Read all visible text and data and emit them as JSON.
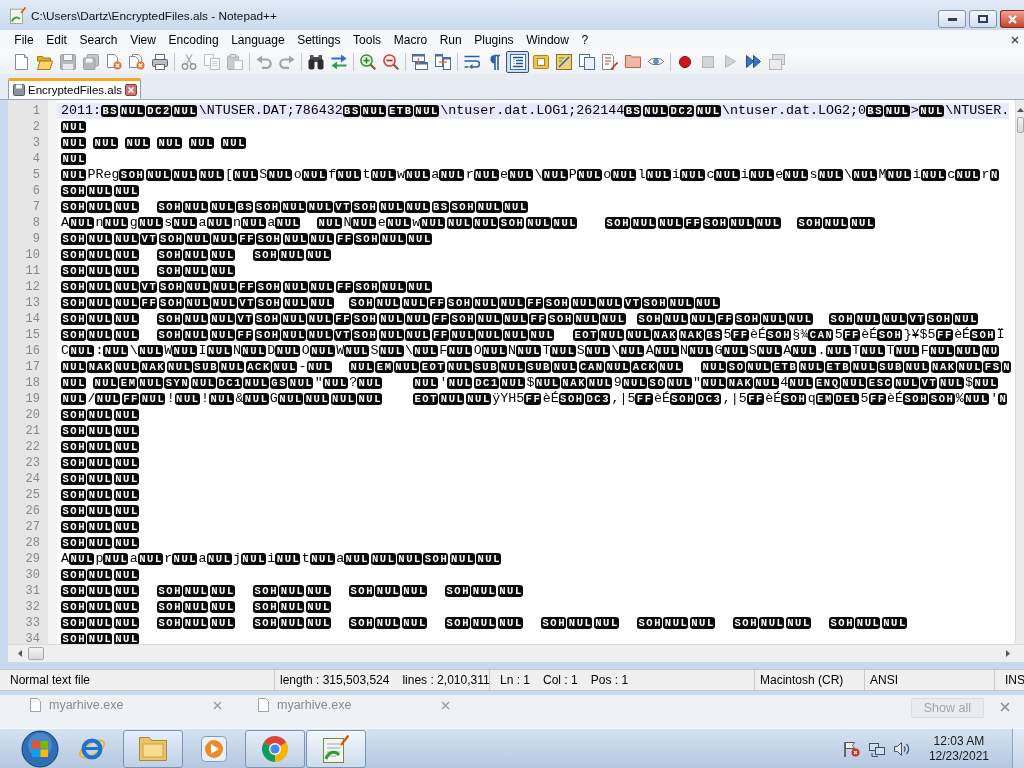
{
  "window": {
    "title": "C:\\Users\\Dartz\\EncryptedFiles.als - Notepad++"
  },
  "menu": [
    "File",
    "Edit",
    "Search",
    "View",
    "Encoding",
    "Language",
    "Settings",
    "Tools",
    "Macro",
    "Run",
    "Plugins",
    "Window",
    "?"
  ],
  "toolbar": [
    {
      "kind": "new",
      "pressed": false,
      "disabled": false
    },
    {
      "kind": "open",
      "pressed": false,
      "disabled": false
    },
    {
      "kind": "save",
      "pressed": false,
      "disabled": true
    },
    {
      "kind": "saveall",
      "pressed": false,
      "disabled": true
    },
    {
      "kind": "close",
      "pressed": false,
      "disabled": false
    },
    {
      "kind": "closeall",
      "pressed": false,
      "disabled": false
    },
    {
      "kind": "print",
      "pressed": false,
      "disabled": false
    },
    {
      "kind": "separator"
    },
    {
      "kind": "cut",
      "pressed": false,
      "disabled": true
    },
    {
      "kind": "copy",
      "pressed": false,
      "disabled": true
    },
    {
      "kind": "paste",
      "pressed": false,
      "disabled": true
    },
    {
      "kind": "separator"
    },
    {
      "kind": "undo",
      "pressed": false,
      "disabled": true
    },
    {
      "kind": "redo",
      "pressed": false,
      "disabled": true
    },
    {
      "kind": "separator"
    },
    {
      "kind": "find",
      "pressed": false,
      "disabled": false
    },
    {
      "kind": "replace",
      "pressed": false,
      "disabled": false
    },
    {
      "kind": "separator"
    },
    {
      "kind": "zoomin",
      "pressed": false,
      "disabled": false
    },
    {
      "kind": "zoomout",
      "pressed": false,
      "disabled": false
    },
    {
      "kind": "separator"
    },
    {
      "kind": "syncv",
      "pressed": false,
      "disabled": false
    },
    {
      "kind": "synch",
      "pressed": false,
      "disabled": false
    },
    {
      "kind": "separator"
    },
    {
      "kind": "wrap",
      "pressed": false,
      "disabled": false
    },
    {
      "kind": "allchars",
      "pressed": false,
      "disabled": false
    },
    {
      "kind": "indentguide",
      "pressed": true,
      "disabled": false
    },
    {
      "kind": "udl",
      "pressed": false,
      "disabled": false
    },
    {
      "kind": "docmap",
      "pressed": false,
      "disabled": false
    },
    {
      "kind": "doclist",
      "pressed": false,
      "disabled": false
    },
    {
      "kind": "funclist",
      "pressed": false,
      "disabled": false
    },
    {
      "kind": "folder",
      "pressed": false,
      "disabled": false
    },
    {
      "kind": "monitor",
      "pressed": false,
      "disabled": false
    },
    {
      "kind": "separator"
    },
    {
      "kind": "record",
      "pressed": false,
      "disabled": false
    },
    {
      "kind": "stop",
      "pressed": false,
      "disabled": true
    },
    {
      "kind": "play",
      "pressed": false,
      "disabled": true
    },
    {
      "kind": "playmulti",
      "pressed": false,
      "disabled": false
    },
    {
      "kind": "savemacro",
      "pressed": false,
      "disabled": true
    }
  ],
  "tabs": [
    {
      "label": "EncryptedFiles.als",
      "selected": true
    }
  ],
  "editor": {
    "lines": [
      {
        "number": "1",
        "current": true,
        "groups": [
          [
            {
              "text": "2011:",
              "controls": [
                "BS",
                "NUL",
                "DC2",
                "NUL"
              ]
            },
            {
              "text": "\\NTUSER.DAT;786432",
              "controls": [
                "BS",
                "NUL",
                "ETB",
                "NUL"
              ]
            },
            {
              "text": "\\ntuser.dat.LOG1;262144",
              "controls": [
                "BS",
                "NUL",
                "DC2",
                "NUL"
              ]
            },
            {
              "text": "\\ntuser.dat.LOG2;0",
              "controls": [
                "BS",
                "NUL"
              ]
            },
            {
              "text": ">",
              "controls": [
                "NUL"
              ]
            },
            {
              "text": "\\NTUSER."
            }
          ]
        ]
      },
      {
        "number": "2",
        "current": false,
        "groups": [
          [
            {
              "controls": [
                "NUL"
              ]
            }
          ]
        ]
      },
      {
        "number": "3",
        "current": false,
        "groups": [
          [
            {
              "controls": [
                "NUL"
              ]
            }
          ],
          [
            {
              "controls": [
                "NUL"
              ]
            }
          ],
          [
            {
              "controls": [
                "NUL"
              ]
            }
          ],
          [
            {
              "controls": [
                "NUL"
              ]
            }
          ],
          [
            {
              "controls": [
                "NUL"
              ]
            }
          ],
          [
            {
              "controls": [
                "NUL"
              ]
            }
          ]
        ]
      },
      {
        "number": "4",
        "current": false,
        "groups": [
          [
            {
              "controls": [
                "NUL"
              ]
            }
          ]
        ]
      },
      {
        "number": "5",
        "current": false,
        "groups": [
          [
            {
              "controls": [
                "NUL"
              ]
            },
            {
              "text": "PReg",
              "controls": [
                "SOH",
                "NUL",
                "NUL",
                "NUL"
              ]
            },
            {
              "text": "[",
              "controls": [
                "NUL"
              ]
            },
            {
              "text": "S",
              "controls": [
                "NUL"
              ]
            },
            {
              "text": "o",
              "controls": [
                "NUL"
              ]
            },
            {
              "text": "f",
              "controls": [
                "NUL"
              ]
            },
            {
              "text": "t",
              "controls": [
                "NUL"
              ]
            },
            {
              "text": "w",
              "controls": [
                "NUL"
              ]
            },
            {
              "text": "a",
              "controls": [
                "NUL"
              ]
            },
            {
              "text": "r",
              "controls": [
                "NUL"
              ]
            },
            {
              "text": "e",
              "controls": [
                "NUL"
              ]
            },
            {
              "text": "\\",
              "controls": [
                "NUL"
              ]
            },
            {
              "text": "P",
              "controls": [
                "NUL"
              ]
            },
            {
              "text": "o",
              "controls": [
                "NUL"
              ]
            },
            {
              "text": "l",
              "controls": [
                "NUL"
              ]
            },
            {
              "text": "i",
              "controls": [
                "NUL"
              ]
            },
            {
              "text": "c",
              "controls": [
                "NUL"
              ]
            },
            {
              "text": "i",
              "controls": [
                "NUL"
              ]
            },
            {
              "text": "e",
              "controls": [
                "NUL"
              ]
            },
            {
              "text": "s",
              "controls": [
                "NUL"
              ]
            },
            {
              "text": "\\",
              "controls": [
                "NUL"
              ]
            },
            {
              "text": "M",
              "controls": [
                "NUL"
              ]
            },
            {
              "text": "i",
              "controls": [
                "NUL"
              ]
            },
            {
              "text": "c",
              "controls": [
                "NUL"
              ]
            },
            {
              "text": "r",
              "controls": [
                "N"
              ]
            }
          ]
        ]
      },
      {
        "number": "6",
        "current": false,
        "groups": [
          [
            {
              "controls": [
                "SOH",
                "NUL",
                "NUL"
              ]
            }
          ]
        ]
      },
      {
        "number": "7",
        "current": false,
        "groups": [
          [
            {
              "controls": [
                "SOH",
                "NUL",
                "NUL"
              ]
            }
          ],
          [
            {
              "controls": [
                "SOH",
                "NUL",
                "NUL",
                "BS",
                "SOH",
                "NUL",
                "NUL",
                "VT",
                "SOH",
                "NUL",
                "NUL",
                "BS",
                "SOH",
                "NUL",
                "NUL"
              ]
            }
          ]
        ]
      },
      {
        "number": "8",
        "current": false,
        "groups": [
          [
            {
              "text": "A",
              "controls": [
                "NUL"
              ]
            },
            {
              "text": "n",
              "controls": [
                "NUL"
              ]
            },
            {
              "text": "g",
              "controls": [
                "NUL"
              ]
            },
            {
              "text": "s",
              "controls": [
                "NUL"
              ]
            },
            {
              "text": "a",
              "controls": [
                "NUL"
              ]
            },
            {
              "text": "n",
              "controls": [
                "NUL"
              ]
            },
            {
              "text": "a",
              "controls": [
                "NUL"
              ]
            }
          ],
          [
            {
              "controls": [
                "NUL"
              ]
            },
            {
              "text": "N",
              "controls": [
                "NUL"
              ]
            },
            {
              "text": "e",
              "controls": [
                "NUL"
              ]
            },
            {
              "text": "w",
              "controls": [
                "NUL",
                "NUL",
                "NUL",
                "SOH",
                "NUL",
                "NUL"
              ]
            }
          ],
          [
            {
              "controls": [
                "SOH",
                "NUL",
                "NUL",
                "FF",
                "SOH",
                "NUL",
                "NUL"
              ]
            }
          ],
          [
            {
              "controls": [
                "SOH",
                "NUL",
                "NUL"
              ]
            }
          ]
        ]
      },
      {
        "number": "9",
        "current": false,
        "groups": [
          [
            {
              "controls": [
                "SOH",
                "NUL",
                "NUL",
                "VT",
                "SOH",
                "NUL",
                "NUL",
                "FF",
                "SOH",
                "NUL",
                "NUL",
                "FF",
                "SOH",
                "NUL",
                "NUL"
              ]
            }
          ]
        ]
      },
      {
        "number": "10",
        "current": false,
        "groups": [
          [
            {
              "controls": [
                "SOH",
                "NUL",
                "NUL"
              ]
            }
          ],
          [
            {
              "controls": [
                "SOH",
                "NUL",
                "NUL"
              ]
            }
          ],
          [
            {
              "controls": [
                "SOH",
                "NUL",
                "NUL"
              ]
            }
          ]
        ]
      },
      {
        "number": "11",
        "current": false,
        "groups": [
          [
            {
              "controls": [
                "SOH",
                "NUL",
                "NUL"
              ]
            }
          ],
          [
            {
              "controls": [
                "SOH",
                "NUL",
                "NUL"
              ]
            }
          ]
        ]
      },
      {
        "number": "12",
        "current": false,
        "groups": [
          [
            {
              "controls": [
                "SOH",
                "NUL",
                "NUL",
                "VT",
                "SOH",
                "NUL",
                "NUL",
                "FF",
                "SOH",
                "NUL",
                "NUL",
                "FF",
                "SOH",
                "NUL",
                "NUL"
              ]
            }
          ]
        ]
      },
      {
        "number": "13",
        "current": false,
        "groups": [
          [
            {
              "controls": [
                "SOH",
                "NUL",
                "NUL",
                "FF",
                "SOH",
                "NUL",
                "NUL",
                "VT",
                "SOH",
                "NUL",
                "NUL"
              ]
            }
          ],
          [
            {
              "controls": [
                "SOH",
                "NUL",
                "NUL",
                "FF",
                "SOH",
                "NUL",
                "NUL",
                "FF",
                "SOH",
                "NUL",
                "NUL",
                "VT",
                "SOH",
                "NUL",
                "NUL"
              ]
            }
          ]
        ]
      },
      {
        "number": "14",
        "current": false,
        "groups": [
          [
            {
              "controls": [
                "SOH",
                "NUL",
                "NUL"
              ]
            }
          ],
          [
            {
              "controls": [
                "SOH",
                "NUL",
                "NUL",
                "VT",
                "SOH",
                "NUL",
                "NUL",
                "FF",
                "SOH",
                "NUL",
                "NUL",
                "FF",
                "SOH",
                "NUL",
                "NUL",
                "FF",
                "SOH",
                "NUL",
                "NUL"
              ]
            }
          ],
          [
            {
              "controls": [
                "SOH",
                "NUL",
                "NUL",
                "FF",
                "SOH",
                "NUL",
                "NUL"
              ]
            }
          ],
          [
            {
              "controls": [
                "SOH",
                "NUL",
                "NUL",
                "VT",
                "SOH",
                "NUL"
              ]
            }
          ]
        ]
      },
      {
        "number": "15",
        "current": false,
        "groups": [
          [
            {
              "controls": [
                "SOH",
                "NUL",
                "NUL"
              ]
            }
          ],
          [
            {
              "controls": [
                "SOH",
                "NUL",
                "NUL",
                "FF",
                "SOH",
                "NUL",
                "NUL",
                "VT",
                "SOH",
                "NUL",
                "NUL",
                "FF",
                "NUL",
                "NUL",
                "NUL",
                "NUL"
              ]
            }
          ],
          [
            {
              "controls": [
                "EOT",
                "NUL",
                "NUL",
                "NAK",
                "NAK",
                "BS"
              ]
            },
            {
              "text": "5",
              "controls": [
                "FF"
              ]
            },
            {
              "text": "èÉ",
              "controls": [
                "SOH"
              ]
            },
            {
              "text": "§¾",
              "controls": [
                "CAN"
              ]
            },
            {
              "text": "5",
              "controls": [
                "FF"
              ]
            },
            {
              "text": "èÉ",
              "controls": [
                "SOH"
              ]
            },
            {
              "text": "}¥$5",
              "controls": [
                "FF"
              ]
            },
            {
              "text": "èÉ",
              "controls": [
                "SOH"
              ]
            },
            {
              "text": "Ï"
            }
          ]
        ]
      },
      {
        "number": "16",
        "current": false,
        "groups": [
          [
            {
              "text": "C",
              "controls": [
                "NUL"
              ]
            },
            {
              "text": ":",
              "controls": [
                "NUL"
              ]
            },
            {
              "text": "\\",
              "controls": [
                "NUL"
              ]
            },
            {
              "text": "W",
              "controls": [
                "NUL"
              ]
            },
            {
              "text": "I",
              "controls": [
                "NUL"
              ]
            },
            {
              "text": "N",
              "controls": [
                "NUL"
              ]
            },
            {
              "text": "D",
              "controls": [
                "NUL"
              ]
            },
            {
              "text": "O",
              "controls": [
                "NUL"
              ]
            },
            {
              "text": "W",
              "controls": [
                "NUL"
              ]
            },
            {
              "text": "S",
              "controls": [
                "NUL"
              ]
            },
            {
              "text": "\\",
              "controls": [
                "NUL"
              ]
            },
            {
              "text": "F",
              "controls": [
                "NUL"
              ]
            },
            {
              "text": "O",
              "controls": [
                "NUL"
              ]
            },
            {
              "text": "N",
              "controls": [
                "NUL"
              ]
            },
            {
              "text": "T",
              "controls": [
                "NUL"
              ]
            },
            {
              "text": "S",
              "controls": [
                "NUL"
              ]
            },
            {
              "text": "\\",
              "controls": [
                "NUL"
              ]
            },
            {
              "text": "A",
              "controls": [
                "NUL"
              ]
            },
            {
              "text": "N",
              "controls": [
                "NUL"
              ]
            },
            {
              "text": "G",
              "controls": [
                "NUL"
              ]
            },
            {
              "text": "S",
              "controls": [
                "NUL"
              ]
            },
            {
              "text": "A",
              "controls": [
                "NUL"
              ]
            },
            {
              "text": ".",
              "controls": [
                "NUL"
              ]
            },
            {
              "text": "T",
              "controls": [
                "NUL"
              ]
            },
            {
              "text": "T",
              "controls": [
                "NUL"
              ]
            },
            {
              "text": "F",
              "controls": [
                "NUL",
                "NUL",
                "NU"
              ]
            }
          ]
        ]
      },
      {
        "number": "17",
        "current": false,
        "groups": [
          [
            {
              "controls": [
                "NUL",
                "NAK",
                "NUL",
                "NAK",
                "NUL",
                "SUB",
                "NUL",
                "ACK",
                "NUL"
              ]
            },
            {
              "text": "-",
              "controls": [
                "NUL"
              ]
            }
          ],
          [
            {
              "controls": [
                "NUL",
                "EM",
                "NUL",
                "EOT",
                "NUL",
                "SUB",
                "NUL",
                "SUB",
                "NUL",
                "CAN",
                "NUL",
                "ACK",
                "NUL"
              ]
            }
          ],
          [
            {
              "controls": [
                "NUL",
                "SO",
                "NUL",
                "ETB",
                "NUL",
                "ETB",
                "NUL",
                "SUB",
                "NUL",
                "NAK",
                "NUL",
                "FS",
                "N"
              ]
            }
          ]
        ]
      },
      {
        "number": "18",
        "current": false,
        "groups": [
          [
            {
              "controls": [
                "NUL"
              ]
            }
          ],
          [
            {
              "controls": [
                "NUL",
                "EM",
                "NUL",
                "SYN",
                "NUL",
                "DC1",
                "NUL",
                "GS",
                "NUL"
              ]
            },
            {
              "text": "\"",
              "controls": [
                "NUL"
              ]
            },
            {
              "text": "?",
              "controls": [
                "NUL"
              ]
            }
          ],
          [
            {
              "controls": [
                "NUL"
              ]
            },
            {
              "text": "'",
              "controls": [
                "NUL",
                "DC1",
                "NUL"
              ]
            },
            {
              "text": "$",
              "controls": [
                "NUL",
                "NAK",
                "NUL"
              ]
            },
            {
              "text": "9",
              "controls": [
                "NUL",
                "SO",
                "NUL"
              ]
            },
            {
              "text": "\"",
              "controls": [
                "NUL",
                "NAK",
                "NUL"
              ]
            },
            {
              "text": "4",
              "controls": [
                "NUL",
                "ENQ",
                "NUL",
                "ESC",
                "NUL",
                "VT",
                "NUL"
              ]
            },
            {
              "text": "$",
              "controls": [
                "NUL"
              ]
            }
          ]
        ]
      },
      {
        "number": "19",
        "current": false,
        "groups": [
          [
            {
              "controls": [
                "NUL"
              ]
            },
            {
              "text": "/",
              "controls": [
                "NUL",
                "FF",
                "NUL"
              ]
            },
            {
              "text": "!",
              "controls": [
                "NUL"
              ]
            },
            {
              "text": "!",
              "controls": [
                "NUL"
              ]
            },
            {
              "text": "&",
              "controls": [
                "NUL"
              ]
            },
            {
              "text": "G",
              "controls": [
                "NUL",
                "NUL",
                "NUL",
                "NUL"
              ]
            }
          ],
          [
            {
              "controls": [
                "EOT",
                "NUL",
                "NUL"
              ]
            },
            {
              "text": "ÿYH5",
              "controls": [
                "FF"
              ]
            },
            {
              "text": "èÉ",
              "controls": [
                "SOH",
                "DC3"
              ]
            },
            {
              "text": ",|5",
              "controls": [
                "FF"
              ]
            },
            {
              "text": "èÉ",
              "controls": [
                "SOH",
                "DC3"
              ]
            },
            {
              "text": ",|5",
              "controls": [
                "FF"
              ]
            },
            {
              "text": "èÉ",
              "controls": [
                "SOH"
              ]
            },
            {
              "text": "q",
              "controls": [
                "EM",
                "DEL"
              ]
            },
            {
              "text": "5",
              "controls": [
                "FF"
              ]
            },
            {
              "text": "èÉ",
              "controls": [
                "SOH",
                "SOH"
              ]
            },
            {
              "text": "%",
              "controls": [
                "NUL"
              ]
            },
            {
              "text": "'",
              "controls": [
                "N"
              ]
            }
          ]
        ]
      },
      {
        "number": "20",
        "current": false,
        "groups": [
          [
            {
              "controls": [
                "SOH",
                "NUL",
                "NUL"
              ]
            }
          ]
        ]
      },
      {
        "number": "21",
        "current": false,
        "groups": [
          [
            {
              "controls": [
                "SOH",
                "NUL",
                "NUL"
              ]
            }
          ]
        ]
      },
      {
        "number": "22",
        "current": false,
        "groups": [
          [
            {
              "controls": [
                "SOH",
                "NUL",
                "NUL"
              ]
            }
          ]
        ]
      },
      {
        "number": "23",
        "current": false,
        "groups": [
          [
            {
              "controls": [
                "SOH",
                "NUL",
                "NUL"
              ]
            }
          ]
        ]
      },
      {
        "number": "24",
        "current": false,
        "groups": [
          [
            {
              "controls": [
                "SOH",
                "NUL",
                "NUL"
              ]
            }
          ]
        ]
      },
      {
        "number": "25",
        "current": false,
        "groups": [
          [
            {
              "controls": [
                "SOH",
                "NUL",
                "NUL"
              ]
            }
          ]
        ]
      },
      {
        "number": "26",
        "current": false,
        "groups": [
          [
            {
              "controls": [
                "SOH",
                "NUL",
                "NUL"
              ]
            }
          ]
        ]
      },
      {
        "number": "27",
        "current": false,
        "groups": [
          [
            {
              "controls": [
                "SOH",
                "NUL",
                "NUL"
              ]
            }
          ]
        ]
      },
      {
        "number": "28",
        "current": false,
        "groups": [
          [
            {
              "controls": [
                "SOH",
                "NUL",
                "NUL"
              ]
            }
          ]
        ]
      },
      {
        "number": "29",
        "current": false,
        "groups": [
          [
            {
              "text": "A",
              "controls": [
                "NUL"
              ]
            },
            {
              "text": "p",
              "controls": [
                "NUL"
              ]
            },
            {
              "text": "a",
              "controls": [
                "NUL"
              ]
            },
            {
              "text": "r",
              "controls": [
                "NUL"
              ]
            },
            {
              "text": "a",
              "controls": [
                "NUL"
              ]
            },
            {
              "text": "j",
              "controls": [
                "NUL"
              ]
            },
            {
              "text": "i",
              "controls": [
                "NUL"
              ]
            },
            {
              "text": "t",
              "controls": [
                "NUL"
              ]
            },
            {
              "text": "a",
              "controls": [
                "NUL",
                "NUL",
                "NUL",
                "SOH",
                "NUL",
                "NUL"
              ]
            }
          ]
        ]
      },
      {
        "number": "30",
        "current": false,
        "groups": [
          [
            {
              "controls": [
                "SOH",
                "NUL",
                "NUL"
              ]
            }
          ]
        ]
      },
      {
        "number": "31",
        "current": false,
        "groups": [
          [
            {
              "controls": [
                "SOH",
                "NUL",
                "NUL"
              ]
            }
          ],
          [
            {
              "controls": [
                "SOH",
                "NUL",
                "NUL"
              ]
            }
          ],
          [
            {
              "controls": [
                "SOH",
                "NUL",
                "NUL"
              ]
            }
          ],
          [
            {
              "controls": [
                "SOH",
                "NUL",
                "NUL"
              ]
            }
          ],
          [
            {
              "controls": [
                "SOH",
                "NUL",
                "NUL"
              ]
            }
          ]
        ]
      },
      {
        "number": "32",
        "current": false,
        "groups": [
          [
            {
              "controls": [
                "SOH",
                "NUL",
                "NUL"
              ]
            }
          ],
          [
            {
              "controls": [
                "SOH",
                "NUL",
                "NUL"
              ]
            }
          ],
          [
            {
              "controls": [
                "SOH",
                "NUL",
                "NUL"
              ]
            }
          ]
        ]
      },
      {
        "number": "33",
        "current": false,
        "groups": [
          [
            {
              "controls": [
                "SOH",
                "NUL",
                "NUL"
              ]
            }
          ],
          [
            {
              "controls": [
                "SOH",
                "NUL",
                "NUL"
              ]
            }
          ],
          [
            {
              "controls": [
                "SOH",
                "NUL",
                "NUL"
              ]
            }
          ],
          [
            {
              "controls": [
                "SOH",
                "NUL",
                "NUL"
              ]
            }
          ],
          [
            {
              "controls": [
                "SOH",
                "NUL",
                "NUL"
              ]
            }
          ],
          [
            {
              "controls": [
                "SOH",
                "NUL",
                "NUL"
              ]
            }
          ],
          [
            {
              "controls": [
                "SOH",
                "NUL",
                "NUL"
              ]
            }
          ],
          [
            {
              "controls": [
                "SOH",
                "NUL",
                "NUL"
              ]
            }
          ],
          [
            {
              "controls": [
                "SOH",
                "NUL",
                "NUL"
              ]
            }
          ]
        ]
      },
      {
        "number": "34",
        "current": false,
        "groups": [
          [
            {
              "controls": [
                "SOH",
                "NUL",
                "NUL"
              ]
            }
          ]
        ]
      }
    ]
  },
  "status_bar": {
    "file_type": "Normal text file",
    "length": "length : 315,503,524",
    "lines": "lines : 2,010,311",
    "line": "Ln : 1",
    "column": "Col : 1",
    "position": "Pos : 1",
    "line_endings": "Macintosh (CR)",
    "encoding": "ANSI",
    "mode": "INS"
  },
  "downloads": {
    "items": [
      {
        "name": "myarhive.exe"
      },
      {
        "name": "myarhive.exe"
      }
    ],
    "show_all": "Show all"
  },
  "taskbar": {
    "apps": [
      {
        "kind": "globe",
        "open": false,
        "active": false
      },
      {
        "kind": "folders",
        "open": true,
        "active": false
      },
      {
        "kind": "player",
        "open": false,
        "active": false
      },
      {
        "kind": "browser",
        "open": true,
        "active": false
      },
      {
        "kind": "editor",
        "open": true,
        "active": true
      }
    ],
    "clock": {
      "time": "12:03 AM",
      "date": "12/23/2021"
    }
  }
}
